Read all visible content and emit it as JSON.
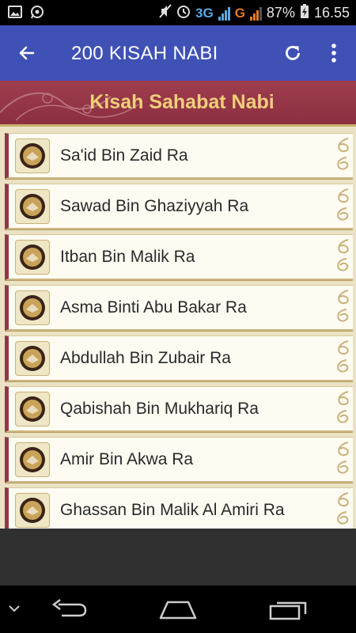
{
  "status_bar": {
    "battery_percent": "87%",
    "time": "16.55",
    "network_1": "3G",
    "network_2": "G"
  },
  "app_bar": {
    "title": "200 KISAH NABI"
  },
  "section": {
    "title": "Kisah Sahabat Nabi"
  },
  "items": [
    {
      "label": "Sa'id Bin Zaid Ra"
    },
    {
      "label": "Sawad Bin Ghaziyyah Ra"
    },
    {
      "label": "Itban Bin Malik Ra"
    },
    {
      "label": "Asma Binti Abu Bakar Ra"
    },
    {
      "label": "Abdullah Bin Zubair Ra"
    },
    {
      "label": "Qabishah Bin Mukhariq Ra"
    },
    {
      "label": "Amir Bin Akwa Ra"
    },
    {
      "label": "Ghassan Bin Malik Al Amiri Ra"
    }
  ],
  "colors": {
    "app_bar": "#3f51b5",
    "banner": "#8c2f40",
    "banner_text": "#f0cf7a",
    "list_bg": "#ebe2c5"
  }
}
